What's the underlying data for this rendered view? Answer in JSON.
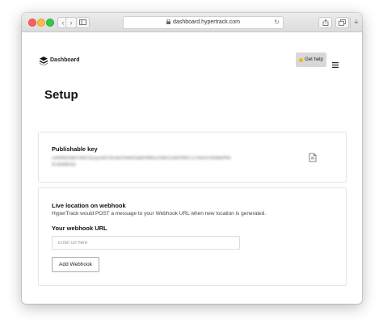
{
  "browser": {
    "url": "dashboard.hypertrack.com"
  },
  "header": {
    "brand": "Dashboard",
    "help_label": "Get help"
  },
  "page": {
    "title": "Setup"
  },
  "publishable_key": {
    "title": "Publishable key",
    "value": "cmVMd0ZkWmlnRkhIQ1gxUE9lRzdqZXhmOXZwWkFRRmxqTWR2SjN6VFRNYjJrN3A4cVE0WmVPNndLdA9mRzQ2"
  },
  "webhook": {
    "title": "Live location on webhook",
    "description": "HyperTrack would POST a message to your Webhook URL when new location is generated.",
    "url_label": "Your webhook URL",
    "url_placeholder": "Enter url here",
    "url_value": "",
    "button_label": "Add Webhook"
  }
}
